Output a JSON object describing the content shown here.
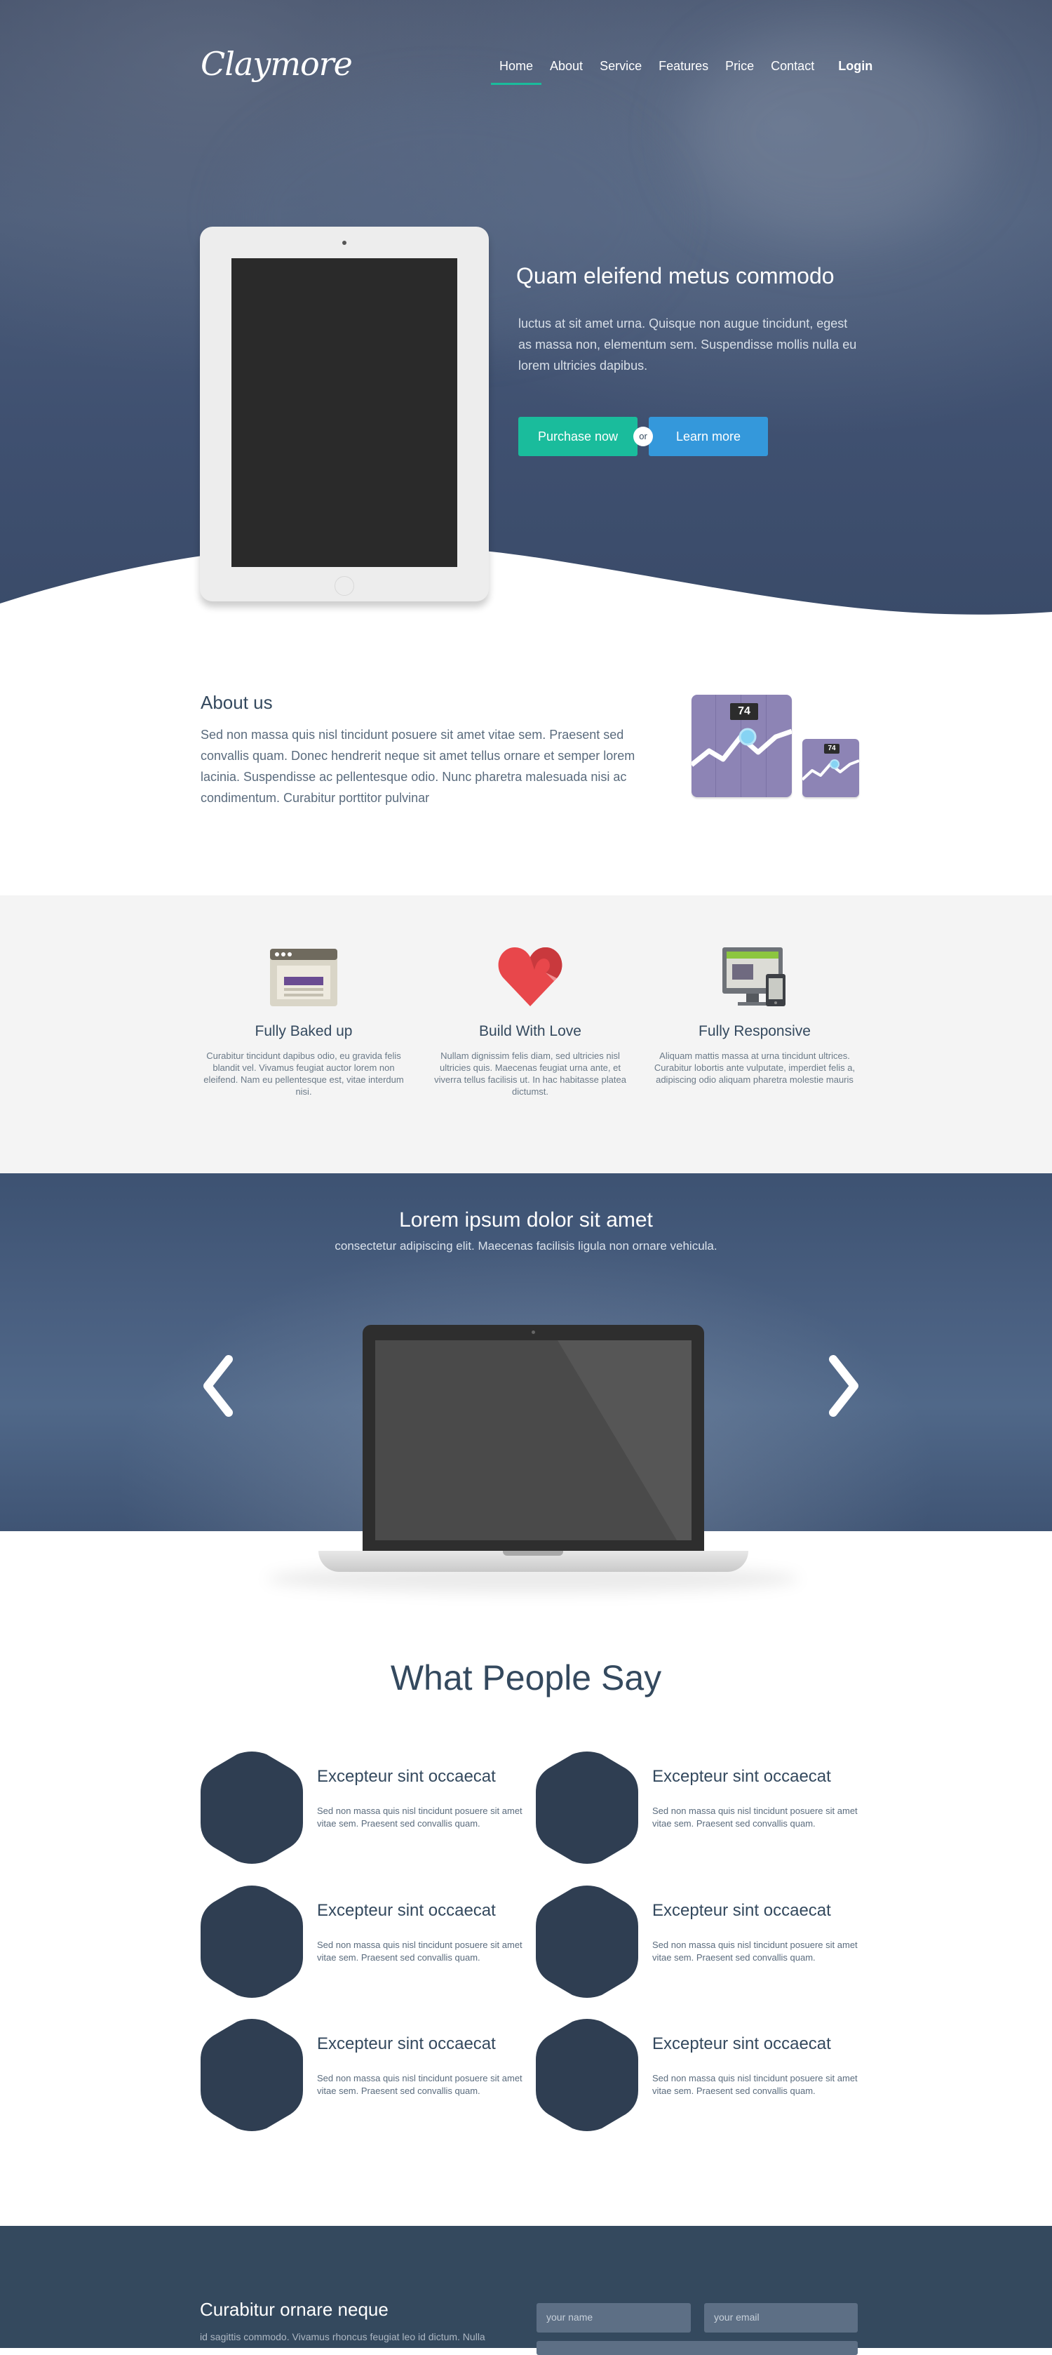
{
  "brand": {
    "logo": "Claymore"
  },
  "nav": {
    "items": [
      {
        "label": "Home",
        "active": true
      },
      {
        "label": "About"
      },
      {
        "label": "Service"
      },
      {
        "label": "Features"
      },
      {
        "label": "Price"
      },
      {
        "label": "Contact"
      }
    ],
    "login": "Login"
  },
  "hero": {
    "title": "Quam eleifend metus commodo",
    "text": "luctus at sit amet urna. Quisque non augue tincidunt, egest as massa non, elementum sem. Suspendisse mollis nulla eu lorem ultricies dapibus.",
    "purchase": "Purchase now",
    "or": "or",
    "learn": "Learn more"
  },
  "about": {
    "title": "About us",
    "text": "Sed non massa quis nisl tincidunt posuere sit amet vitae sem. Praesent sed convallis quam. Donec hendrerit neque sit amet tellus ornare et semper lorem lacinia. Suspendisse ac pellentesque odio. Nunc pharetra malesuada nisi ac condimentum. Curabitur porttitor pulvinar",
    "stat_big": "74",
    "stat_small": "74"
  },
  "features": [
    {
      "title": "Fully Baked up",
      "icon": "browser-window-icon",
      "text": "Curabitur tincidunt dapibus odio, eu gravida felis blandit vel. Vivamus feugiat auctor lorem non eleifend. Nam eu pellentesque est, vitae interdum nisi."
    },
    {
      "title": "Build With Love",
      "icon": "heart-icon",
      "text": "Nullam dignissim felis diam, sed ultricies nisl ultricies quis. Maecenas feugiat urna ante, et viverra tellus facilisis ut. In hac habitasse platea dictumst."
    },
    {
      "title": "Fully Responsive",
      "icon": "devices-icon",
      "text": "Aliquam mattis massa at urna tincidunt ultrices. Curabitur lobortis ante vulputate, imperdiet felis a, adipiscing odio aliquam pharetra molestie mauris"
    }
  ],
  "slider": {
    "title": "Lorem ipsum dolor sit amet",
    "subtitle": "consectetur adipiscing elit. Maecenas facilisis ligula non ornare vehicula."
  },
  "testimonials": {
    "title": "What People Say",
    "items": [
      {
        "title": "Excepteur sint occaecat",
        "text": "Sed non massa quis nisl tincidunt posuere sit amet vitae sem. Praesent sed convallis quam."
      },
      {
        "title": "Excepteur sint occaecat",
        "text": "Sed non massa quis nisl tincidunt posuere sit amet vitae sem. Praesent sed convallis quam."
      },
      {
        "title": "Excepteur sint occaecat",
        "text": "Sed non massa quis nisl tincidunt posuere sit amet vitae sem. Praesent sed convallis quam."
      },
      {
        "title": "Excepteur sint occaecat",
        "text": "Sed non massa quis nisl tincidunt posuere sit amet vitae sem. Praesent sed convallis quam."
      },
      {
        "title": "Excepteur sint occaecat",
        "text": "Sed non massa quis nisl tincidunt posuere sit amet vitae sem. Praesent sed convallis quam."
      },
      {
        "title": "Excepteur sint occaecat",
        "text": "Sed non massa quis nisl tincidunt posuere sit amet vitae sem. Praesent sed convallis quam."
      }
    ]
  },
  "footer": {
    "title": "Curabitur ornare neque",
    "text": "id sagittis commodo. Vivamus rhoncus feugiat leo id dictum. Nulla",
    "name_placeholder": "your name",
    "email_placeholder": "your email"
  },
  "colors": {
    "accent_green": "#1abc9c",
    "accent_blue": "#3498db",
    "dark_navy": "#34495e",
    "hexagon": "#2f3e52",
    "stat_purple": "#8d84b5"
  }
}
